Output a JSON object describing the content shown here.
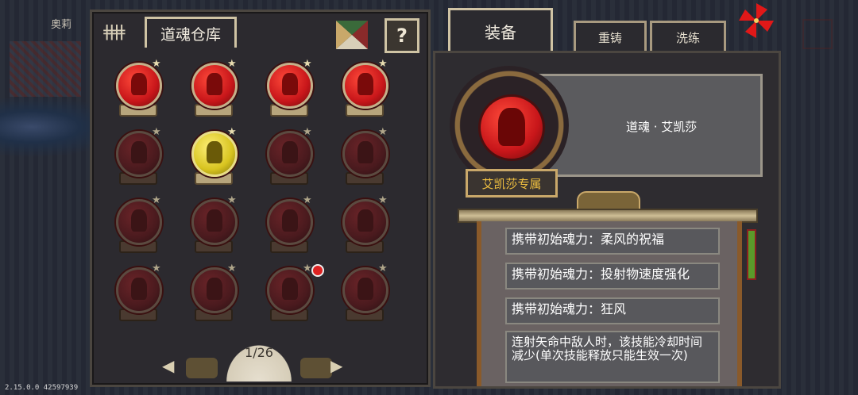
{
  "npc_name": "奥莉",
  "version": "2.15.0.0 42597939",
  "storage": {
    "title": "道魂仓库",
    "page": "1/26",
    "slots": [
      {
        "state": "bright"
      },
      {
        "state": "bright"
      },
      {
        "state": "bright"
      },
      {
        "state": "bright"
      },
      {
        "state": "dim"
      },
      {
        "state": "gold"
      },
      {
        "state": "dim"
      },
      {
        "state": "dim"
      },
      {
        "state": "dim"
      },
      {
        "state": "dim"
      },
      {
        "state": "dim"
      },
      {
        "state": "dim"
      },
      {
        "state": "dim"
      },
      {
        "state": "dim"
      },
      {
        "state": "dim"
      },
      {
        "state": "dim"
      }
    ]
  },
  "tabs": {
    "equip": "装备",
    "recast": "重铸",
    "refine": "洗练"
  },
  "detail": {
    "name": "道魂 · 艾凯莎",
    "exclusive": "艾凯莎专属",
    "skills": [
      "携带初始魂力：柔风的祝福",
      "携带初始魂力：投射物速度强化",
      "携带初始魂力：狂风",
      "连射矢命中敌人时，该技能冷却时间减少(单次技能释放只能生效一次)"
    ]
  },
  "colors": {
    "accent_gold": "#f0c040",
    "orb_red": "#c8161a",
    "orb_gold": "#d8c420"
  },
  "icons": {
    "help": "?",
    "prev": "◀",
    "next": "▶",
    "star": "★"
  }
}
